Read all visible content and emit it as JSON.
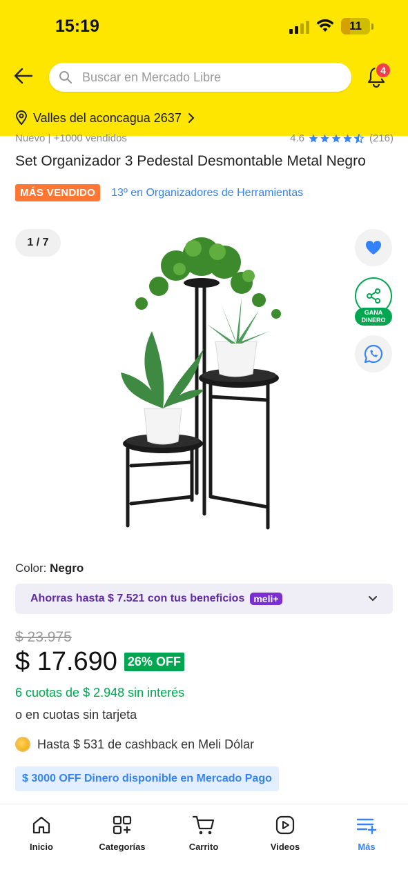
{
  "status_bar": {
    "time": "15:19",
    "battery": "11"
  },
  "header": {
    "search_placeholder": "Buscar en Mercado Libre",
    "notification_count": "4",
    "location": "Valles del aconcagua 2637"
  },
  "product": {
    "condition_sold": "Nuevo  |  +1000 vendidos",
    "rating": "4.6",
    "reviews": "(216)",
    "title": "Set Organizador 3 Pedestal Desmontable Metal Negro",
    "best_seller_badge": "MÁS VENDIDO",
    "ranking": "13º en Organizadores de Herramientas",
    "image_counter": "1 / 7",
    "share_label": "GANA DINERO",
    "color_label": "Color:",
    "color_value": "Negro",
    "benefits_text": "Ahorras hasta $ 7.521 con tus beneficios",
    "meli_plus": "meli+",
    "old_price": "$ 23.975",
    "price": "$ 17.690",
    "discount": "26% OFF",
    "installments": "6 cuotas de $ 2.948 sin interés",
    "no_card": "o en cuotas sin tarjeta",
    "cashback": "Hasta $ 531 de cashback en Meli Dólar",
    "mp_banner": "$ 3000 OFF Dinero disponible en Mercado Pago"
  },
  "tabbar": {
    "items": [
      {
        "label": "Inicio",
        "icon": "home-icon"
      },
      {
        "label": "Categorías",
        "icon": "categories-icon"
      },
      {
        "label": "Carrito",
        "icon": "cart-icon"
      },
      {
        "label": "Videos",
        "icon": "video-icon"
      },
      {
        "label": "Más",
        "icon": "menu-plus-icon"
      }
    ],
    "active": "Más"
  },
  "colors": {
    "header_yellow": "#fee600",
    "accent_blue": "#3483fa",
    "success_green": "#00a650",
    "badge_orange": "#ff7733",
    "meli_purple": "#7b2fd1"
  }
}
